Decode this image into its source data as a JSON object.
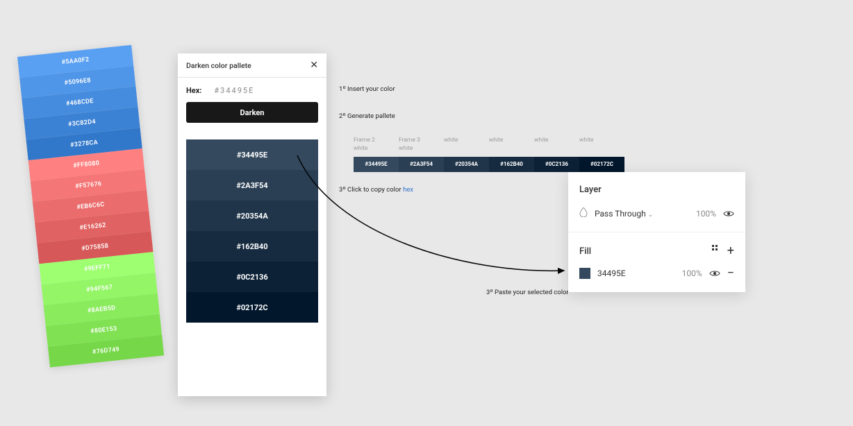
{
  "palette_strip": [
    {
      "hex": "#5AA0F2"
    },
    {
      "hex": "#5096E8"
    },
    {
      "hex": "#468CDE"
    },
    {
      "hex": "#3C82D4"
    },
    {
      "hex": "#3278CA"
    },
    {
      "hex": "#FF8080"
    },
    {
      "hex": "#F57676"
    },
    {
      "hex": "#EB6C6C"
    },
    {
      "hex": "#E16262"
    },
    {
      "hex": "#D75858"
    },
    {
      "hex": "#9EFF71"
    },
    {
      "hex": "#94F567"
    },
    {
      "hex": "#8AEB5D"
    },
    {
      "hex": "#80E153"
    },
    {
      "hex": "#76D749"
    }
  ],
  "plugin": {
    "title": "Darken color pallete",
    "hex_label": "Hex:",
    "hex_value": "#34495E",
    "darken_label": "Darken",
    "generated": [
      {
        "hex": "#34495E"
      },
      {
        "hex": "#2A3F54"
      },
      {
        "hex": "#20354A"
      },
      {
        "hex": "#162B40"
      },
      {
        "hex": "#0C2136"
      },
      {
        "hex": "#02172C"
      }
    ]
  },
  "instructions": {
    "step1": "1º Insert your color",
    "step2": "2º Generate pallete",
    "step3_prefix": "3º Click to copy color ",
    "step3_link": "hex",
    "step4": "3º Paste your selected color"
  },
  "frames": {
    "labels": [
      {
        "name": "Frame 2",
        "sub": "white"
      },
      {
        "name": "Frame 3",
        "sub": "white"
      },
      {
        "name": "",
        "sub": "white"
      },
      {
        "name": "",
        "sub": "white"
      },
      {
        "name": "",
        "sub": "white"
      },
      {
        "name": "",
        "sub": "white"
      }
    ],
    "swatches": [
      {
        "hex": "#34495E"
      },
      {
        "hex": "#2A3F54"
      },
      {
        "hex": "#20354A"
      },
      {
        "hex": "#162B40"
      },
      {
        "hex": "#0C2136"
      },
      {
        "hex": "#02172C"
      }
    ]
  },
  "layer_panel": {
    "layer_label": "Layer",
    "blend_mode": "Pass Through",
    "layer_opacity": "100%",
    "fill_label": "Fill",
    "fill_hex": "34495E",
    "fill_color": "#34495E",
    "fill_opacity": "100%"
  }
}
